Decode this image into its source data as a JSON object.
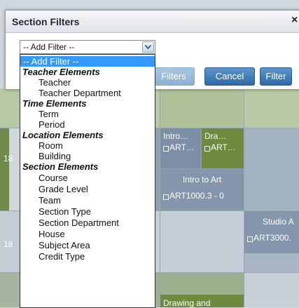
{
  "dialog": {
    "title": "Section Filters",
    "close_label": "×",
    "buttons": {
      "clear": "Filters",
      "cancel": "Cancel",
      "filter": "Filter"
    }
  },
  "select": {
    "value": "-- Add Filter --"
  },
  "dropdown": {
    "selected": "-- Add Filter --",
    "groups": [
      {
        "label": "Teacher Elements",
        "items": [
          "Teacher",
          "Teacher Department"
        ]
      },
      {
        "label": "Time Elements",
        "items": [
          "Term",
          "Period"
        ]
      },
      {
        "label": "Location Elements",
        "items": [
          "Room",
          "Building"
        ]
      },
      {
        "label": "Section Elements",
        "items": [
          "Course",
          "Grade Level",
          "Team",
          "Section Type",
          "Section Department",
          "House",
          "Subject Area",
          "Credit Type"
        ]
      }
    ]
  },
  "schedule": {
    "row_numbers": [
      "18",
      "18"
    ],
    "blocks": {
      "intro_short": "Intro…",
      "intro_short_code": "ART…",
      "dra_short": "Dra…",
      "dra_short_code": "ART…",
      "intro_full": "Intro to Art",
      "intro_full_code": "ART1000.3 - 0",
      "studio": "Studio A",
      "studio_code": "ART3000.",
      "drawing": "Drawing and"
    }
  },
  "colors": {
    "accent": "#3399ff",
    "button": "#2f6aa6",
    "grid_green": "#6f8a4a",
    "grid_slate": "#8896a8"
  }
}
